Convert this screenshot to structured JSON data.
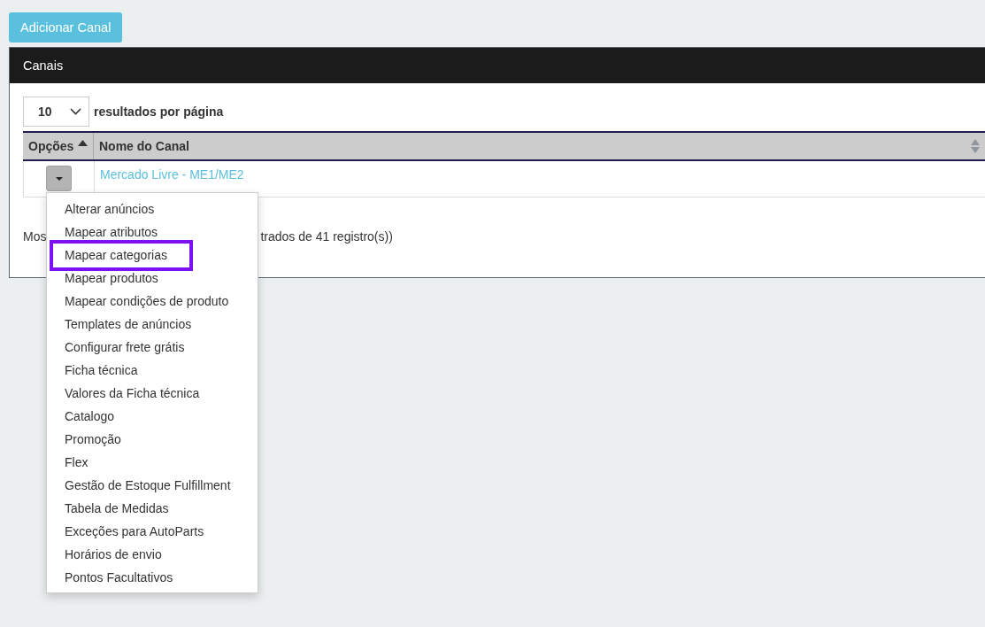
{
  "add_button": "Adicionar Canal",
  "panel": {
    "title": "Canais"
  },
  "page_size": {
    "value": "10",
    "label": "resultados por página"
  },
  "table": {
    "columns": [
      {
        "label": "Opções",
        "sorted_ascending": true
      },
      {
        "label": "Nome do Canal",
        "sorted_ascending": false
      }
    ],
    "rows": [
      {
        "name": "Mercado Livre - ME1/ME2"
      }
    ]
  },
  "info": {
    "start": "Mos",
    "end": "trados de 41 registro(s))"
  },
  "menu": {
    "items": [
      {
        "label": "Alterar anúncios",
        "selected": false
      },
      {
        "label": "Mapear atributos",
        "selected": false
      },
      {
        "label": "Mapear categorias",
        "selected": true
      },
      {
        "label": "Mapear produtos",
        "selected": false
      },
      {
        "label": "Mapear condições de produto",
        "selected": false
      },
      {
        "label": "Templates de anúncios",
        "selected": false
      },
      {
        "label": "Configurar frete grátis",
        "selected": false
      },
      {
        "label": "Ficha técnica",
        "selected": false
      },
      {
        "label": "Valores da Ficha técnica",
        "selected": false
      },
      {
        "label": "Catalogo",
        "selected": false
      },
      {
        "label": "Promoção",
        "selected": false
      },
      {
        "label": "Flex",
        "selected": false
      },
      {
        "label": "Gestão de Estoque Fulfillment",
        "selected": false
      },
      {
        "label": "Tabela de Medidas",
        "selected": false
      },
      {
        "label": "Exceções para AutoParts",
        "selected": false
      },
      {
        "label": "Horários de envio",
        "selected": false
      },
      {
        "label": "Pontos Facultativos",
        "selected": false
      }
    ]
  }
}
